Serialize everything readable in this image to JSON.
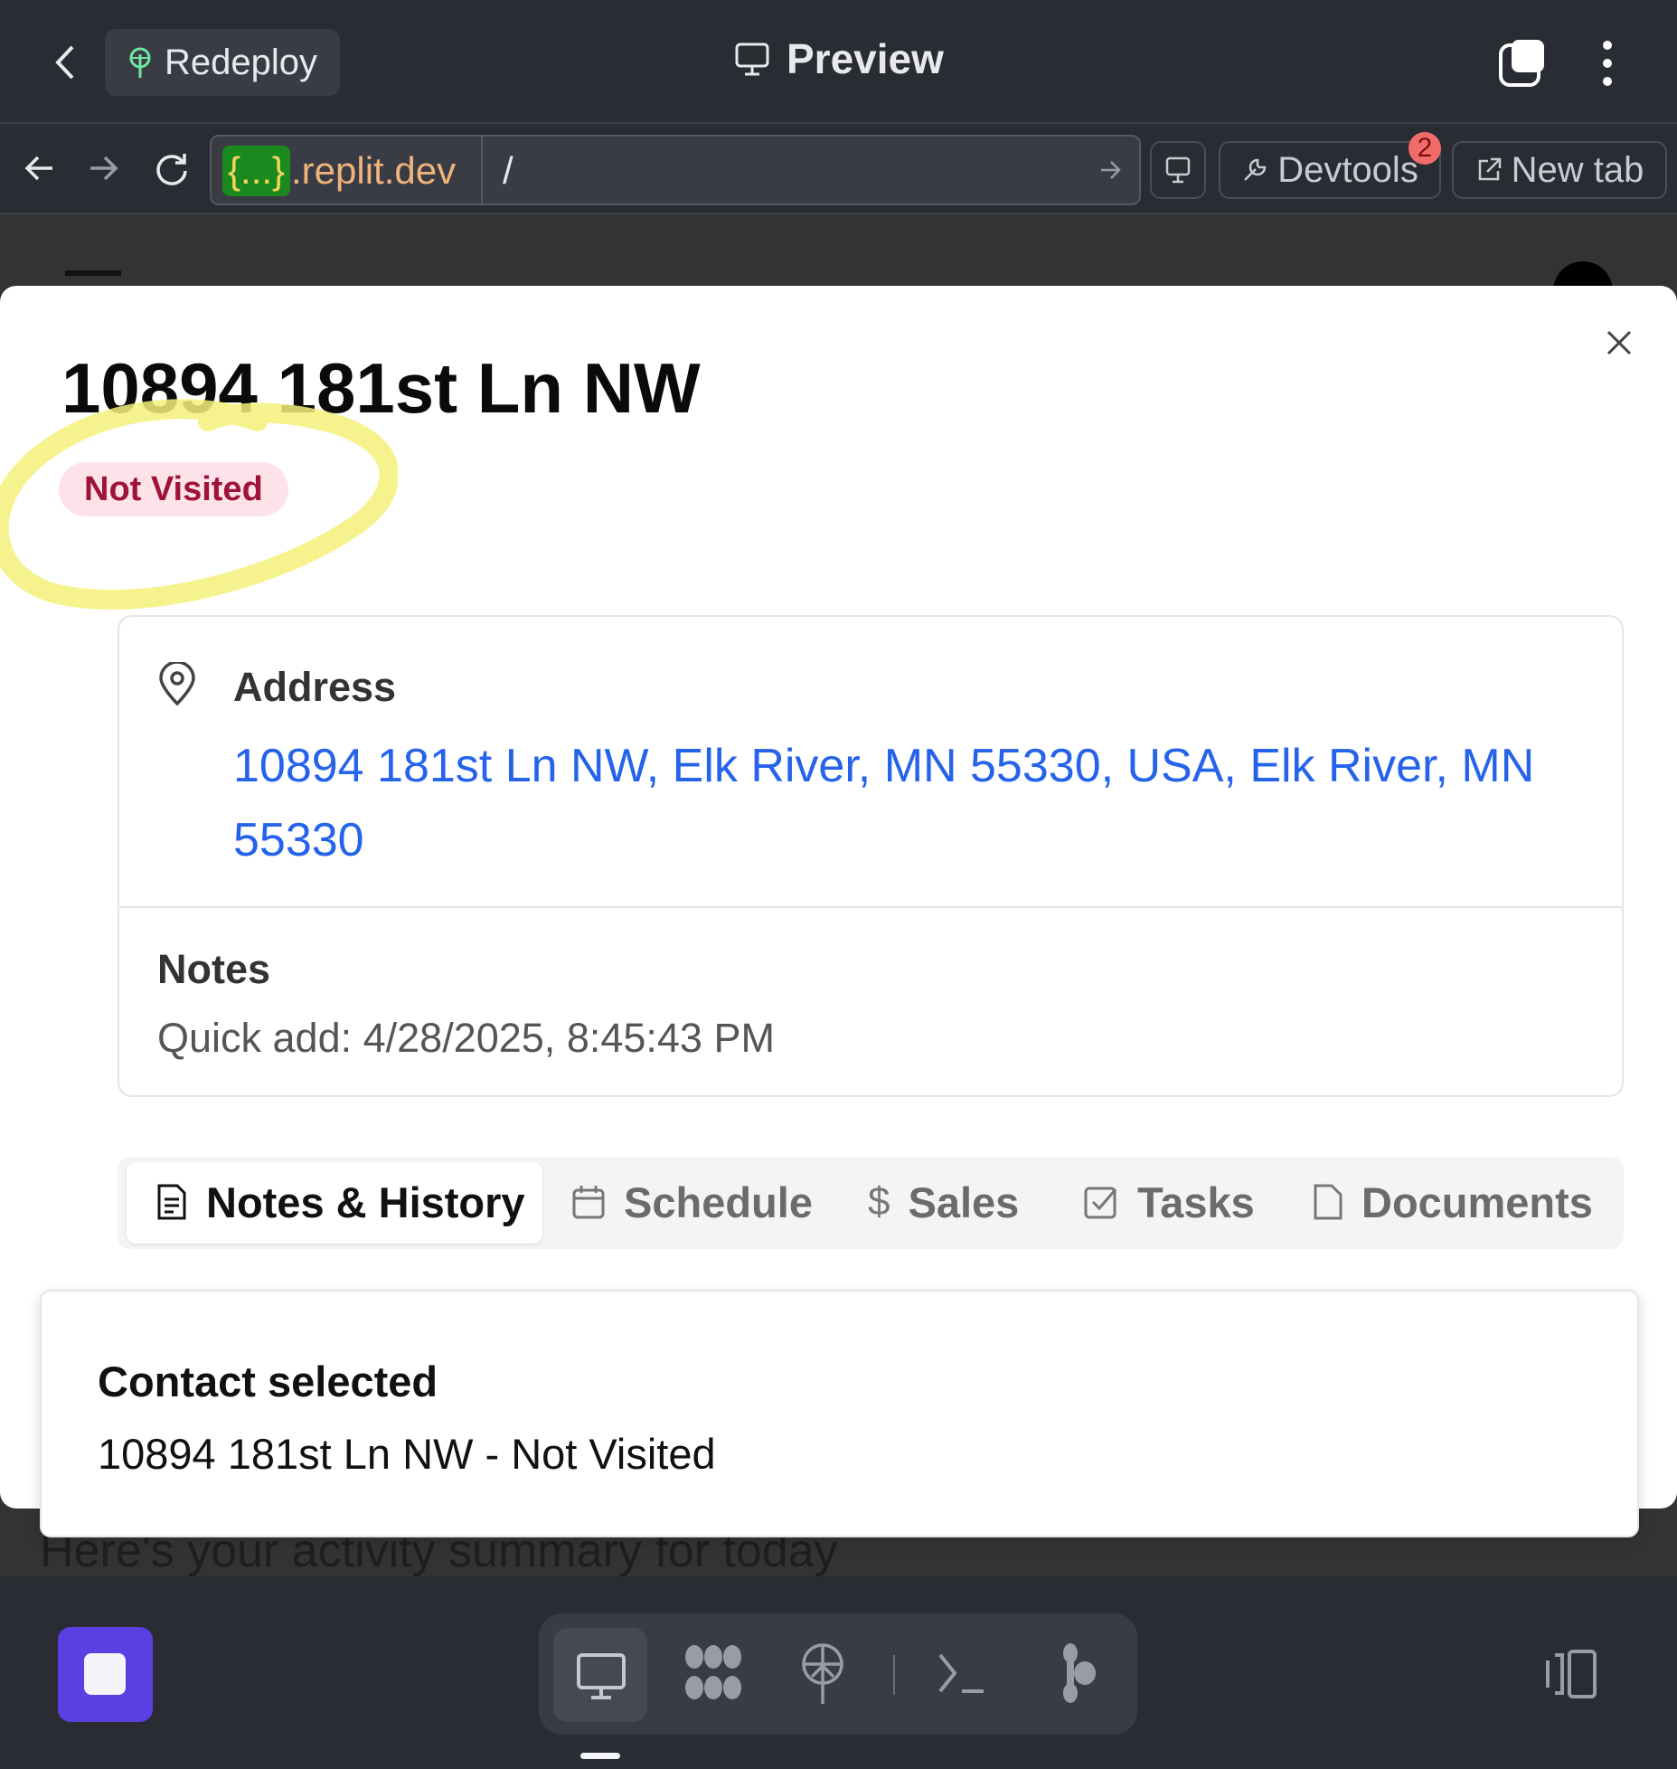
{
  "topbar": {
    "redeploy_label": "Redeploy",
    "title": "Preview"
  },
  "urlbar": {
    "domain_prefix": "{...}",
    "domain": ".replit.dev",
    "path": "/",
    "devtools_label": "Devtools",
    "devtools_badge": "2",
    "new_tab_label": "New tab"
  },
  "background_page": {
    "subtitle": "Here's your activity summary for today"
  },
  "modal": {
    "title": "10894 181st Ln NW",
    "status_badge": "Not Visited",
    "address_label": "Address",
    "address_value": "10894 181st Ln NW, Elk River, MN 55330, USA, Elk River, MN 55330",
    "notes_label": "Notes",
    "notes_value": "Quick add: 4/28/2025, 8:45:43 PM",
    "tabs": [
      {
        "label": "Notes & History",
        "icon": "document-icon",
        "active": true
      },
      {
        "label": "Schedule",
        "icon": "calendar-icon"
      },
      {
        "label": "Sales",
        "icon": "dollar-icon"
      },
      {
        "label": "Tasks",
        "icon": "checkbox-icon"
      },
      {
        "label": "Documents",
        "icon": "file-icon"
      }
    ]
  },
  "toast": {
    "title": "Contact selected",
    "message": "10894 181st Ln NW - Not Visited"
  },
  "colors": {
    "accent_link": "#2563eb",
    "badge_bg": "#fde2ea",
    "badge_text": "#9f1239",
    "stop_button": "#5b3fe0",
    "annotation": "#f4f17a"
  }
}
